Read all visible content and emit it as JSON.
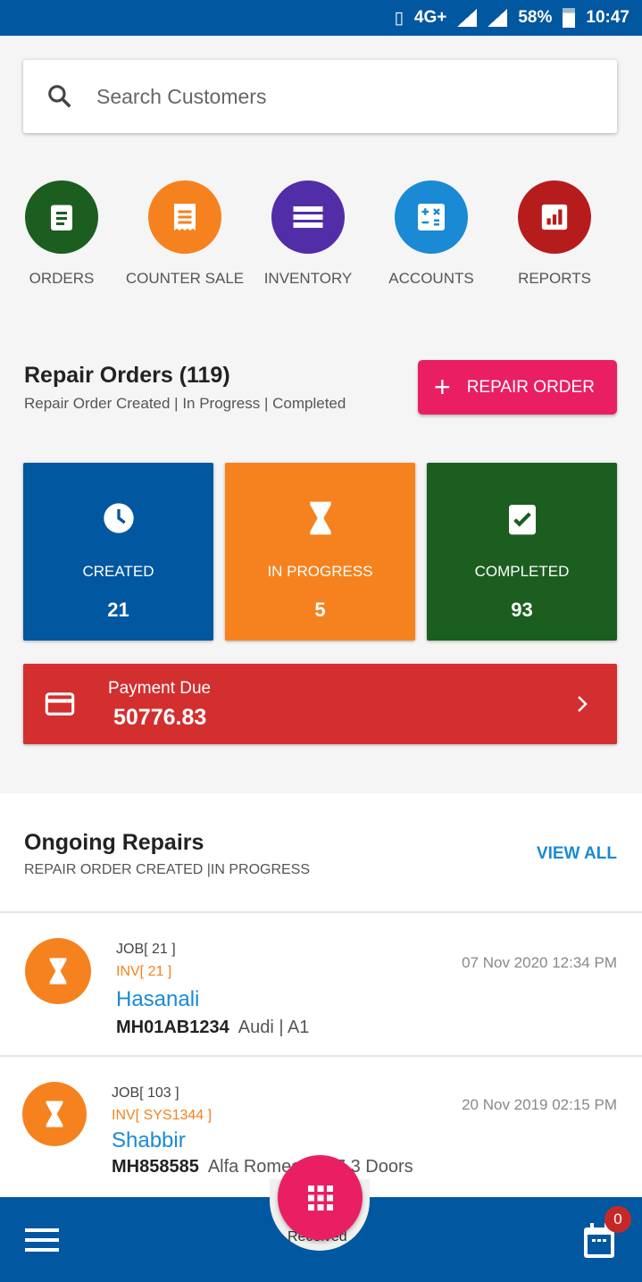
{
  "status_bar": {
    "network": "4G+",
    "battery": "58%",
    "time": "10:47"
  },
  "search": {
    "placeholder": "Search Customers"
  },
  "quick_actions": [
    {
      "label": "ORDERS",
      "color": "#1b5e20",
      "icon": "clipboard-icon"
    },
    {
      "label": "COUNTER SALE",
      "color": "#f5821f",
      "icon": "receipt-icon"
    },
    {
      "label": "INVENTORY",
      "color": "#512da8",
      "icon": "list-icon"
    },
    {
      "label": "ACCOUNTS",
      "color": "#1a8ad4",
      "icon": "calculator-icon"
    },
    {
      "label": "REPORTS",
      "color": "#b71c1c",
      "icon": "chart-icon"
    }
  ],
  "repair_orders": {
    "title": "Repair Orders (119)",
    "subtitle": "Repair Order Created | In Progress | Completed",
    "add_button": "REPAIR ORDER",
    "tiles": [
      {
        "label": "CREATED",
        "value": "21",
        "color": "#0157a0"
      },
      {
        "label": "IN PROGRESS",
        "value": "5",
        "color": "#f5821f"
      },
      {
        "label": "COMPLETED",
        "value": "93",
        "color": "#1b5e20"
      }
    ]
  },
  "payment_due": {
    "label": "Payment Due",
    "amount": "50776.83"
  },
  "ongoing": {
    "title": "Ongoing Repairs",
    "subtitle": "REPAIR ORDER CREATED |IN PROGRESS",
    "view_all": "VIEW ALL",
    "items": [
      {
        "job": "JOB[ 21 ]",
        "inv": "INV[ 21 ]",
        "name": "Hasanali",
        "plate": "MH01AB1234",
        "car": "Audi | A1",
        "date": "07 Nov 2020 12:34 PM"
      },
      {
        "job": "JOB[ 103 ]",
        "inv": "INV[ SYS1344 ]",
        "name": "Shabbir",
        "plate": "MH858585",
        "car": "Alfa Romeo | 147 3 Doors",
        "date": "20 Nov 2019 02:15 PM"
      }
    ]
  },
  "bottom_nav": {
    "fab_caption": "Received",
    "calendar_badge": "0"
  }
}
